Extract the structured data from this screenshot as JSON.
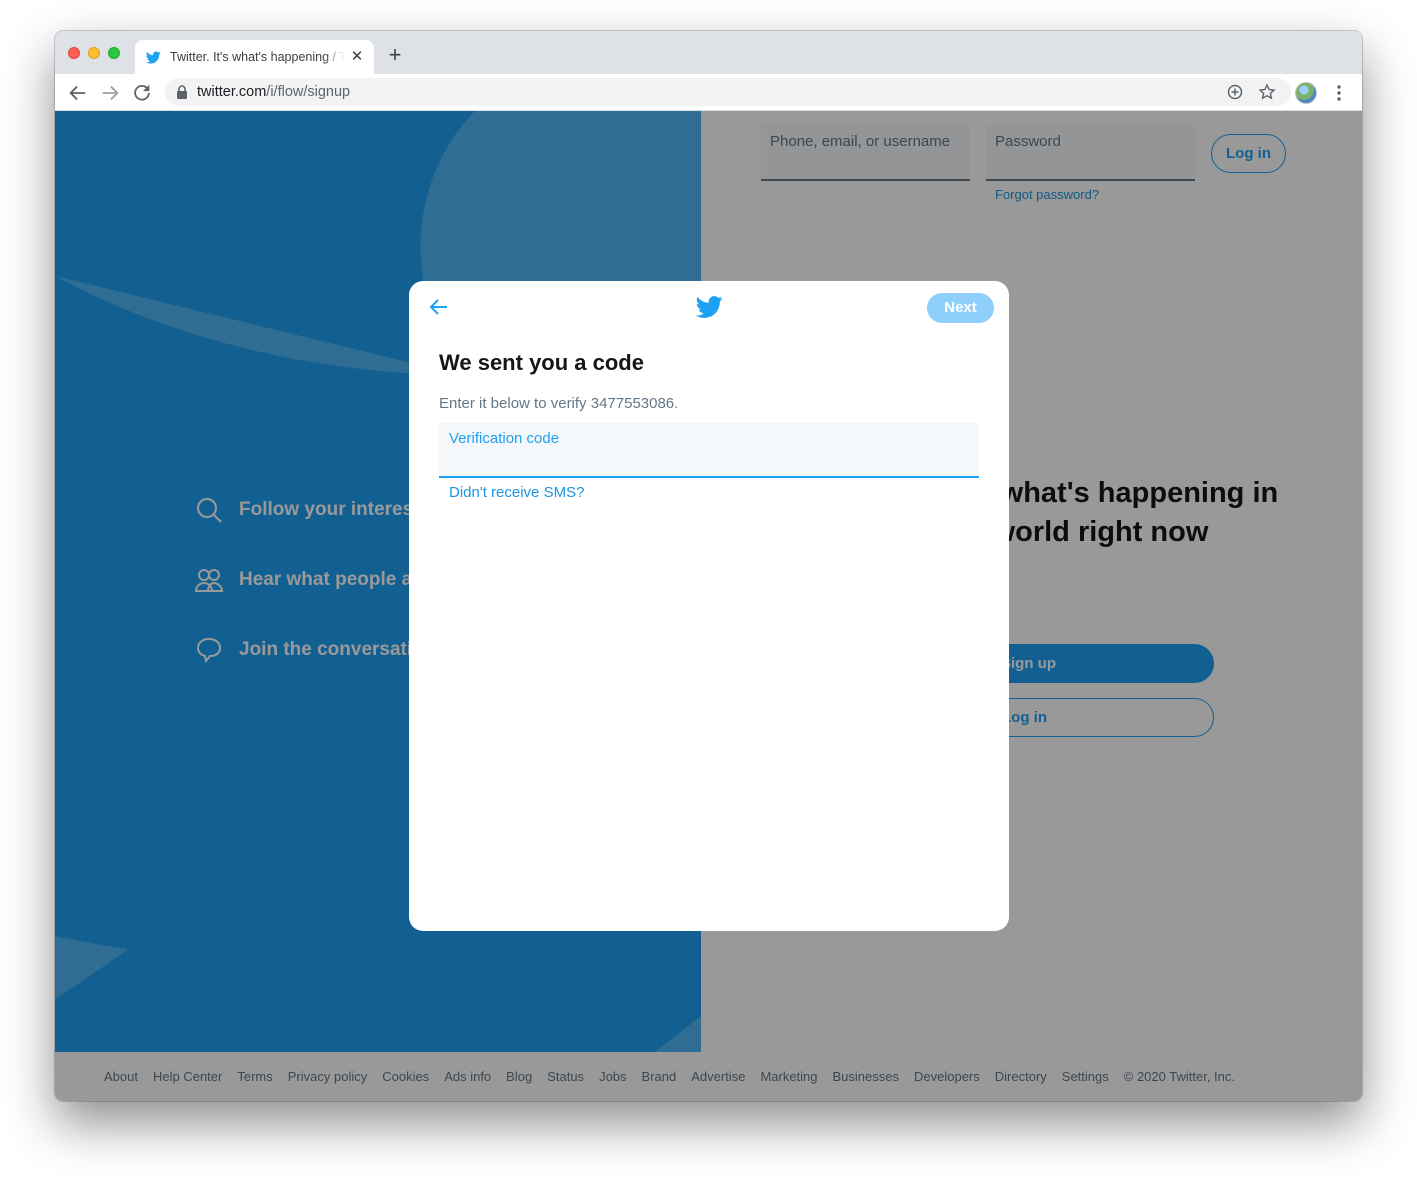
{
  "browser": {
    "tab_title": "Twitter. It's what's happening / Twitter",
    "url_host": "twitter.com",
    "url_path": "/i/flow/signup",
    "new_tab_label": "+",
    "tab_close_label": "✕"
  },
  "login": {
    "username_placeholder": "Phone, email, or username",
    "password_placeholder": "Password",
    "forgot_password": "Forgot password?",
    "login_button": "Log in"
  },
  "features": [
    {
      "icon": "search-icon",
      "label": "Follow your interests."
    },
    {
      "icon": "people-icon",
      "label": "Hear what people are talking about."
    },
    {
      "icon": "chat-bubble-icon",
      "label": "Join the conversation."
    }
  ],
  "hero": {
    "headline_line1": "See what's happening in",
    "headline_line2": "the world right now",
    "signup_button": "Sign up",
    "login_button": "Log in"
  },
  "modal": {
    "next_button": "Next",
    "title": "We sent you a code",
    "subtitle": "Enter it below to verify 3477553086.",
    "code_label": "Verification code",
    "resend_link": "Didn't receive SMS?"
  },
  "footer": {
    "links": [
      "About",
      "Help Center",
      "Terms",
      "Privacy policy",
      "Cookies",
      "Ads info",
      "Blog",
      "Status",
      "Jobs",
      "Brand",
      "Advertise",
      "Marketing",
      "Businesses",
      "Developers",
      "Directory",
      "Settings",
      "© 2020 Twitter, Inc."
    ]
  },
  "colors": {
    "twitter_blue": "#1da1f2",
    "link_blue": "#1b95e0",
    "next_disabled": "#8ed0f9",
    "overlay": "rgba(0,0,0,0.4)"
  }
}
